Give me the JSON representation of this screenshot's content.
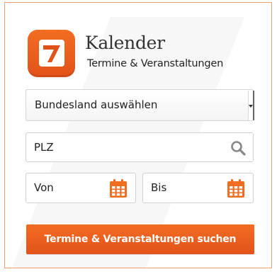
{
  "header": {
    "title": "Kalender",
    "subtitle": "Termine & Veranstaltungen",
    "logo_glyph": "7"
  },
  "form": {
    "state_select": {
      "value": "Bundesland auswählen"
    },
    "zip_input": {
      "placeholder": "PLZ"
    },
    "date_from": {
      "placeholder": "Von"
    },
    "date_to": {
      "placeholder": "Bis"
    },
    "submit_label": "Termine & Veranstaltungen suchen"
  },
  "colors": {
    "accent": "#f26d21",
    "border": "#e8a079",
    "icon_gray": "#888888"
  },
  "icons": [
    "calendar-logo-icon",
    "search-icon",
    "calendar-icon",
    "dropdown-arrow-icon"
  ]
}
